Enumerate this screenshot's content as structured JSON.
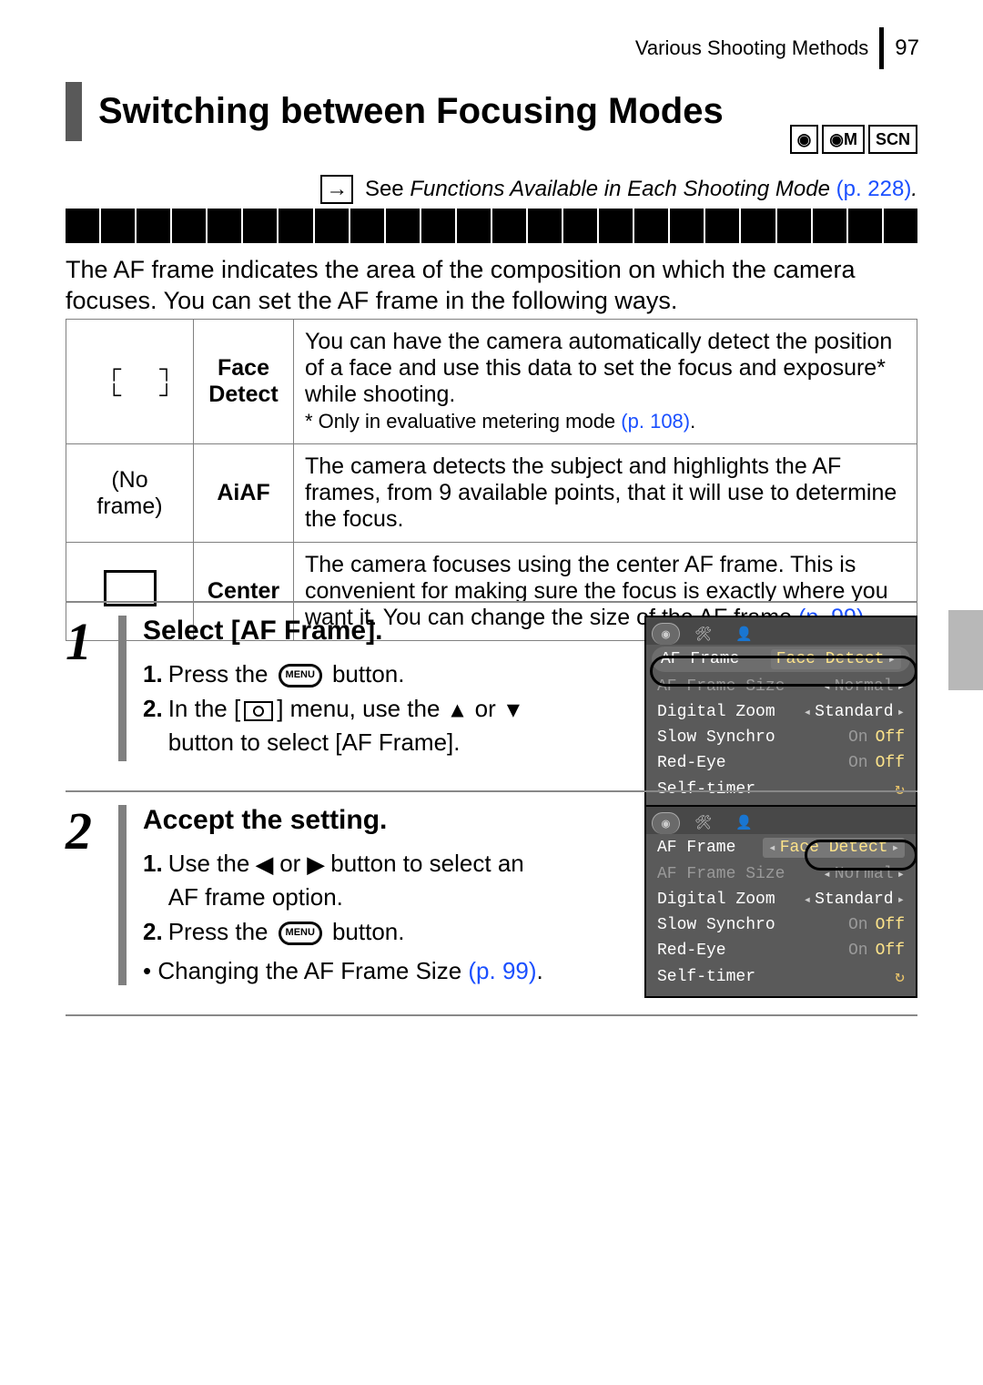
{
  "header": {
    "breadcrumb": "Various Shooting Methods",
    "page": "97"
  },
  "heading": "Switching between Focusing Modes",
  "mode_badges": [
    "◉",
    "◉M",
    "SCN"
  ],
  "reference": {
    "see": "See",
    "text": "Functions Available in Each Shooting Mode",
    "page_ref": "(p. 228)"
  },
  "intro": "The AF frame indicates the area of the composition on which the camera focuses. You can set the AF frame in the following ways.",
  "modes": [
    {
      "icon": "face",
      "name": "Face Detect",
      "desc": "You can have the camera automatically detect the position of a face and use this data to set the focus and exposure* while shooting.",
      "note": "* Only in evaluative metering mode ",
      "note_ref": "(p. 108)"
    },
    {
      "icon": "none",
      "icon_label": "(No frame)",
      "name": "AiAF",
      "desc": "The camera detects the subject and highlights the AF frames, from 9 available points, that it will use to determine the focus."
    },
    {
      "icon": "center",
      "name": "Center",
      "desc": "The camera focuses using the center AF frame. This is convenient for making sure the focus is exactly where you want it. You can change the size of the AF frame ",
      "desc_ref": "(p. 99)"
    }
  ],
  "steps": [
    {
      "num": "1",
      "title": "Select [AF Frame].",
      "items": [
        {
          "n": "1.",
          "pre": "Press the ",
          "widget": "menu",
          "post": " button."
        },
        {
          "n": "2.",
          "pre": "In the [",
          "widget": "cam",
          "post": "] menu, use the ",
          "arrow1": "▲",
          "mid": " or ",
          "arrow2": "▼",
          "tail": " button to select [AF Frame]."
        }
      ],
      "lcd": {
        "highlight_row_label": true,
        "rows": [
          {
            "label": "AF Frame",
            "value": "Face Detect",
            "hl": true,
            "arrow_r": true,
            "value_style": "sel"
          },
          {
            "label": "AF Frame Size",
            "value": "Normal",
            "grey": true,
            "arrow_l": true,
            "arrow_r": true
          },
          {
            "label": "Digital Zoom",
            "value": "Standard",
            "arrow_l": true,
            "arrow_r": true
          },
          {
            "label": "Slow Synchro",
            "value_on_off": true,
            "active": "Off"
          },
          {
            "label": "Red-Eye",
            "value_on_off": true,
            "active": "Off"
          },
          {
            "label": "Self-timer",
            "value": "↻",
            "yellow": true
          }
        ]
      }
    },
    {
      "num": "2",
      "title": "Accept the setting.",
      "items": [
        {
          "n": "1.",
          "pre": "Use the ",
          "arrow1": "◀",
          "mid": " or ",
          "arrow2": "▶",
          "tail": " button to select an AF frame option."
        },
        {
          "n": "2.",
          "pre": "Press the ",
          "widget": "menu",
          "post": " button."
        }
      ],
      "bullet": {
        "text": "Changing the AF Frame Size ",
        "ref": "(p. 99)"
      },
      "lcd": {
        "highlight_value": true,
        "rows": [
          {
            "label": "AF Frame",
            "value": "Face Detect",
            "arrow_l": true,
            "arrow_r": true,
            "value_style": "sel"
          },
          {
            "label": "AF Frame Size",
            "value": "Normal",
            "grey": true,
            "arrow_l": true,
            "arrow_r": true
          },
          {
            "label": "Digital Zoom",
            "value": "Standard",
            "arrow_l": true,
            "arrow_r": true
          },
          {
            "label": "Slow Synchro",
            "value_on_off": true,
            "active": "Off"
          },
          {
            "label": "Red-Eye",
            "value_on_off": true,
            "active": "Off"
          },
          {
            "label": "Self-timer",
            "value": "↻",
            "yellow": true
          }
        ]
      }
    }
  ]
}
